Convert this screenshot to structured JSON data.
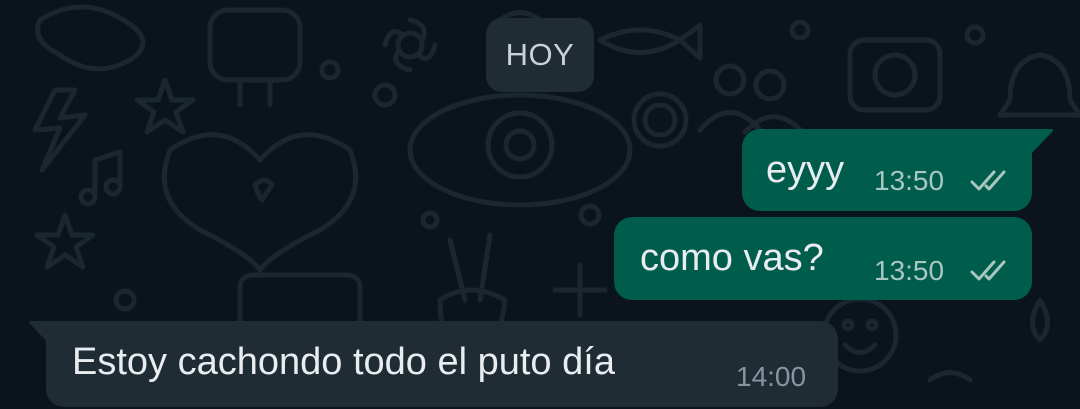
{
  "date_chip": {
    "label": "HOY"
  },
  "messages": [
    {
      "direction": "outgoing",
      "text": "eyyy",
      "time": "13:50",
      "status": "read-double-check"
    },
    {
      "direction": "outgoing",
      "text": "como vas?",
      "time": "13:50",
      "status": "read-double-check"
    },
    {
      "direction": "incoming",
      "text": "Estoy cachondo todo el puto día",
      "time": "14:00"
    }
  ],
  "colors": {
    "background": "#0b141a",
    "outgoing_bubble": "#005c4b",
    "incoming_bubble": "#1f2c34",
    "text": "#e9edef",
    "meta": "#8696a0",
    "wallpaper_doodle": "#1a2730"
  },
  "icons": {
    "read_receipt": "double-check-icon"
  }
}
